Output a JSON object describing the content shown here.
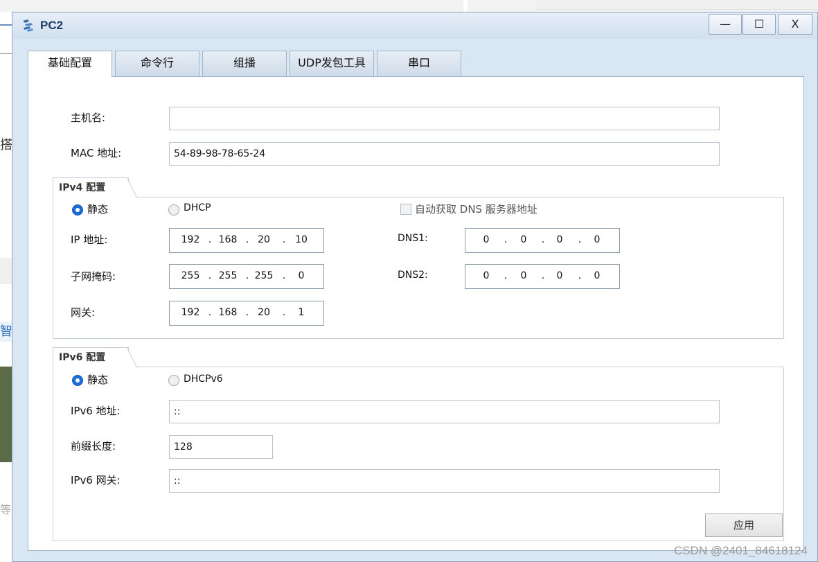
{
  "window": {
    "title": "PC2",
    "minimize": "—",
    "maximize": "☐",
    "close": "X"
  },
  "tabs": [
    {
      "label": "基础配置",
      "active": true
    },
    {
      "label": "命令行"
    },
    {
      "label": "组播"
    },
    {
      "label": "UDP发包工具"
    },
    {
      "label": "串口"
    }
  ],
  "basic": {
    "hostname_label": "主机名:",
    "hostname_value": "",
    "mac_label": "MAC 地址:",
    "mac_value": "54-89-98-78-65-24"
  },
  "ipv4": {
    "title": "IPv4 配置",
    "static_label": "静态",
    "dhcp_label": "DHCP",
    "mode": "static",
    "auto_dns_label": "自动获取 DNS 服务器地址",
    "auto_dns_checked": false,
    "ip_label": "IP 地址:",
    "ip": [
      "192",
      "168",
      "20",
      "10"
    ],
    "mask_label": "子网掩码:",
    "mask": [
      "255",
      "255",
      "255",
      "0"
    ],
    "gateway_label": "网关:",
    "gateway": [
      "192",
      "168",
      "20",
      "1"
    ],
    "dns1_label": "DNS1:",
    "dns1": [
      "0",
      "0",
      "0",
      "0"
    ],
    "dns2_label": "DNS2:",
    "dns2": [
      "0",
      "0",
      "0",
      "0"
    ]
  },
  "ipv6": {
    "title": "IPv6 配置",
    "static_label": "静态",
    "dhcp_label": "DHCPv6",
    "mode": "static",
    "addr_label": "IPv6 地址:",
    "addr_value": "::",
    "prefix_label": "前缀长度:",
    "prefix_value": "128",
    "gateway_label": "IPv6 网关:",
    "gateway_value": "::"
  },
  "apply_label": "应用",
  "watermark": "CSDN @2401_84618124",
  "background_fragments": {
    "a": "搭",
    "b": "智",
    "c": "等"
  },
  "colors": {
    "accent": "#1a6ed8",
    "title": "#1f3c66"
  }
}
